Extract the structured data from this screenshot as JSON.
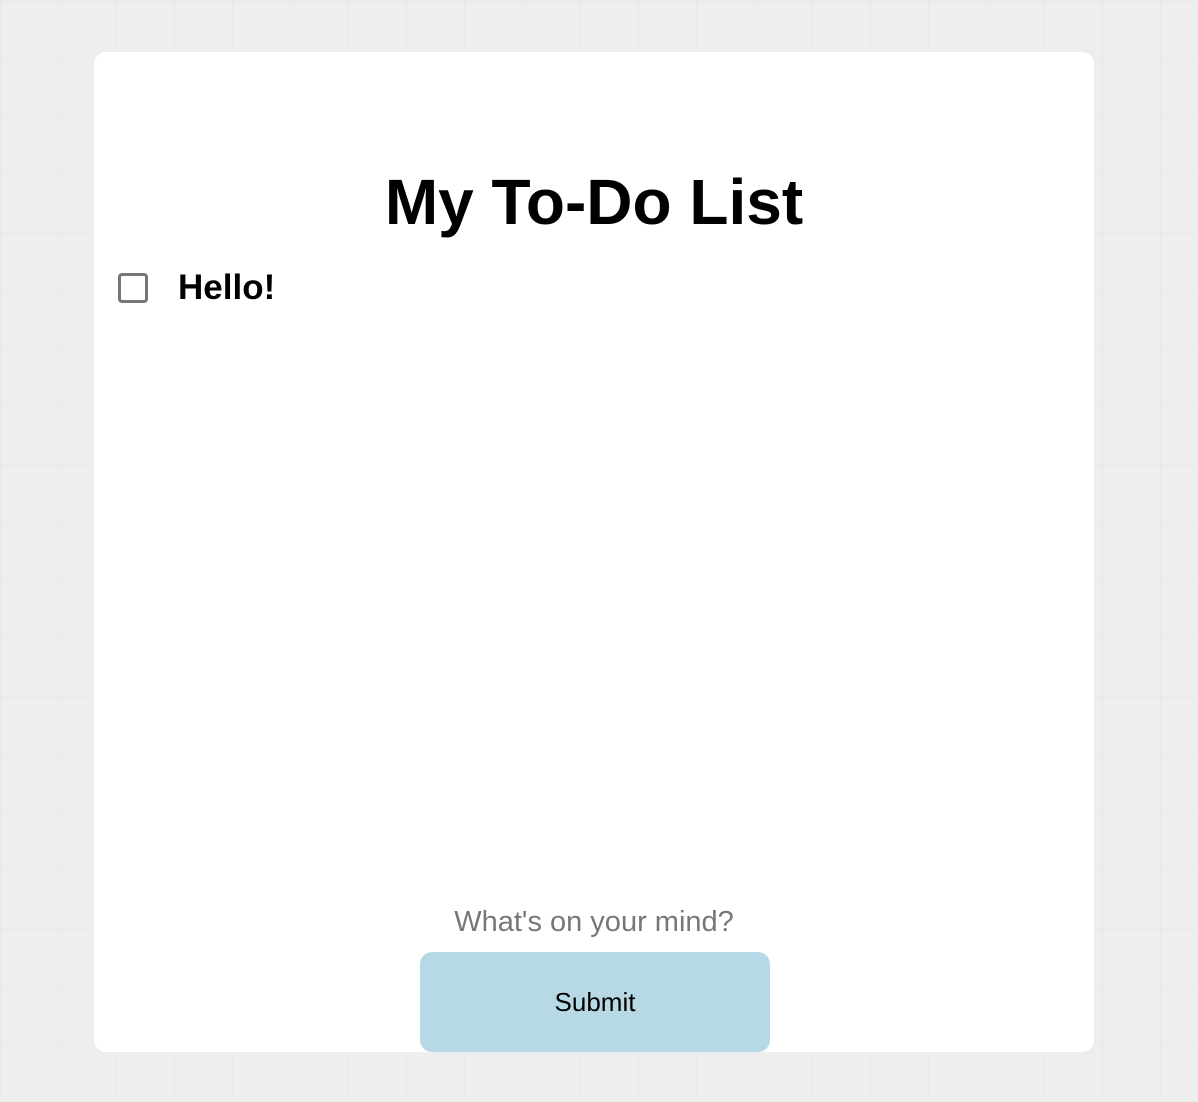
{
  "app": {
    "title": "My To-Do List"
  },
  "todos": [
    {
      "label": "Hello!",
      "checked": false
    }
  ],
  "form": {
    "input_value": "",
    "input_placeholder": "What's on your mind?",
    "submit_label": "Submit"
  },
  "colors": {
    "page_background": "#eeeeee",
    "card_background": "#ffffff",
    "button_background": "#b7d9e5",
    "placeholder_text": "#777777",
    "checkbox_border": "#767676"
  }
}
